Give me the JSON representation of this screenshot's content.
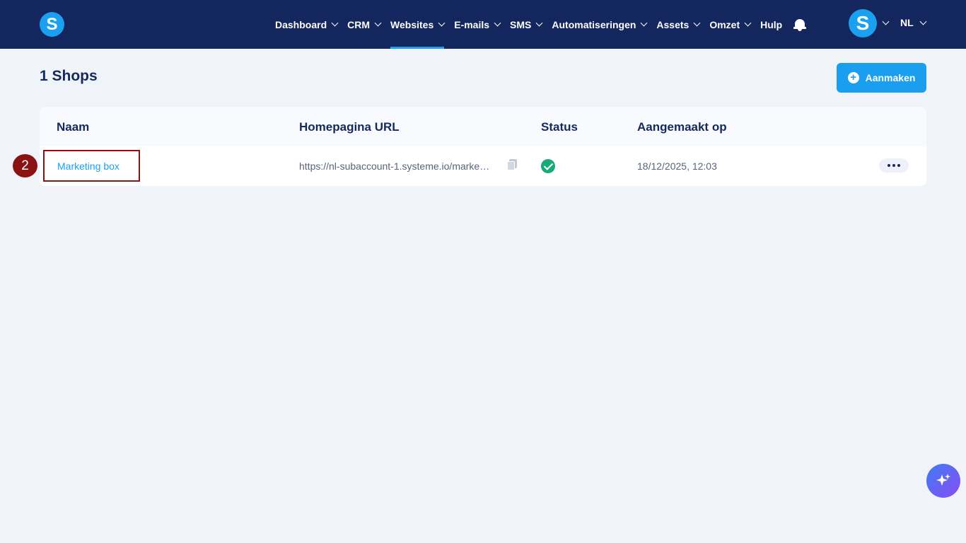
{
  "app": {
    "logo_letter": "S",
    "avatar_letter": "S"
  },
  "nav": {
    "items": [
      {
        "label": "Dashboard",
        "has_dropdown": true
      },
      {
        "label": "CRM",
        "has_dropdown": true
      },
      {
        "label": "Websites",
        "has_dropdown": true,
        "active": true
      },
      {
        "label": "E-mails",
        "has_dropdown": true
      },
      {
        "label": "SMS",
        "has_dropdown": true
      },
      {
        "label": "Automatiseringen",
        "has_dropdown": true
      },
      {
        "label": "Assets",
        "has_dropdown": true
      },
      {
        "label": "Omzet",
        "has_dropdown": true
      },
      {
        "label": "Hulp",
        "has_dropdown": false
      }
    ],
    "language": "NL"
  },
  "page": {
    "title": "1 Shops",
    "create_label": "Aanmaken"
  },
  "table": {
    "headers": {
      "name": "Naam",
      "url": "Homepagina URL",
      "status": "Status",
      "created": "Aangemaakt op"
    },
    "rows": [
      {
        "name": "Marketing box",
        "url": "https://nl-subaccount-1.systeme.io/marke…",
        "status": "active",
        "created": "18/12/2025, 12:03"
      }
    ]
  },
  "annotation": {
    "step": "2"
  },
  "colors": {
    "topbar": "#13275e",
    "accent": "#1a9ff0",
    "success": "#18ab7a",
    "highlight": "#8b1212",
    "background": "#f0f4f9"
  },
  "icons": [
    "bell-icon",
    "copy-icon",
    "check-circle-icon",
    "more-icon",
    "sparkle-icon",
    "plus-icon",
    "chevron-down-icon"
  ]
}
